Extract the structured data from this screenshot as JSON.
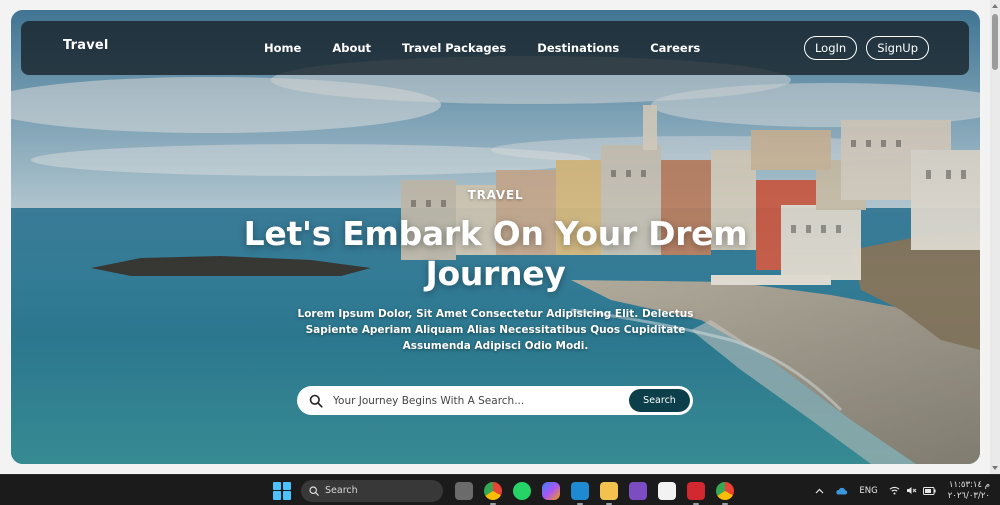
{
  "navbar": {
    "brand": "Travel",
    "links": [
      "Home",
      "About",
      "Travel Packages",
      "Destinations",
      "Careers"
    ],
    "login_label": "LogIn",
    "signup_label": "SignUp"
  },
  "hero": {
    "eyebrow": "TRAVEL",
    "headline": "Let's Embark On Your Drem Journey",
    "subtext": "Lorem Ipsum Dolor, Sit Amet Consectetur Adipisicing Elit. Delectus Sapiente Aperiam Aliquam Alias Necessitatibus Quos Cupiditate Assumenda Adipisci Odio Modi.",
    "search_placeholder": "Your Journey Begins With A Search...",
    "search_button": "Search"
  },
  "colors": {
    "search_button_bg": "#0d3f4b",
    "navbar_bg": "#162026",
    "taskbar_bg": "#1b1b1b"
  },
  "taskbar": {
    "search_label": "Search",
    "apps": [
      "file-explorer-icon",
      "chrome-icon",
      "whatsapp-icon",
      "copilot-icon",
      "vscode-icon",
      "folder-icon",
      "visual-studio-icon",
      "notepad-icon",
      "wps-icon",
      "chrome-profile-icon"
    ],
    "tray": {
      "language": "ENG",
      "time": "م ١١:٥٣:١٤",
      "date": "٢٠٢٦/٠٣/٢٠"
    }
  }
}
